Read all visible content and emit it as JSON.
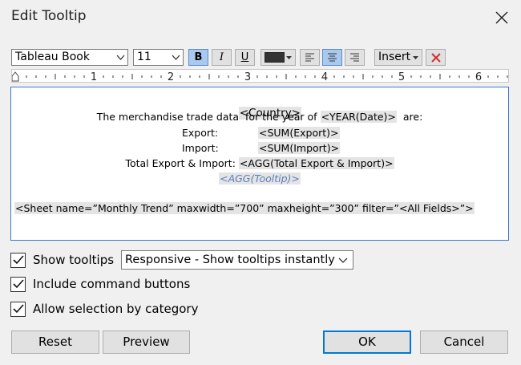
{
  "dialog": {
    "title": "Edit Tooltip"
  },
  "toolbar": {
    "font_family": "Tableau Book",
    "font_size": "11",
    "bold": "B",
    "italic": "I",
    "underline": "U",
    "text_color": "#333333",
    "insert_label": "Insert"
  },
  "ruler": {
    "marks": [
      "1",
      "2",
      "3",
      "4",
      "5",
      "6"
    ]
  },
  "editor": {
    "country": "<Country>",
    "line2_text": "The merchandise trade data  for the year of ",
    "line2_field": "<YEAR(Date)>",
    "line2_tail": "  are:",
    "export_label": "Export:",
    "export_field": "<SUM(Export)>",
    "import_label": "Import:",
    "import_field": "<SUM(Import)>",
    "total_label": "Total Export & Import: ",
    "total_field": "<AGG(Total Export & Import)>",
    "tooltip_field": "<AGG(Tooltip)>",
    "sheet_tag": "<Sheet name=”Monthly Trend” maxwidth=”700” maxheight=”300” filter=”<All Fields>”>"
  },
  "options": {
    "show_tooltips": {
      "label": "Show tooltips",
      "checked": true
    },
    "tooltip_mode": "Responsive - Show tooltips instantly",
    "include_buttons": {
      "label": "Include command buttons",
      "checked": true
    },
    "allow_selection": {
      "label": "Allow selection by category",
      "checked": true
    }
  },
  "buttons": {
    "reset": "Reset",
    "preview": "Preview",
    "ok": "OK",
    "cancel": "Cancel"
  }
}
